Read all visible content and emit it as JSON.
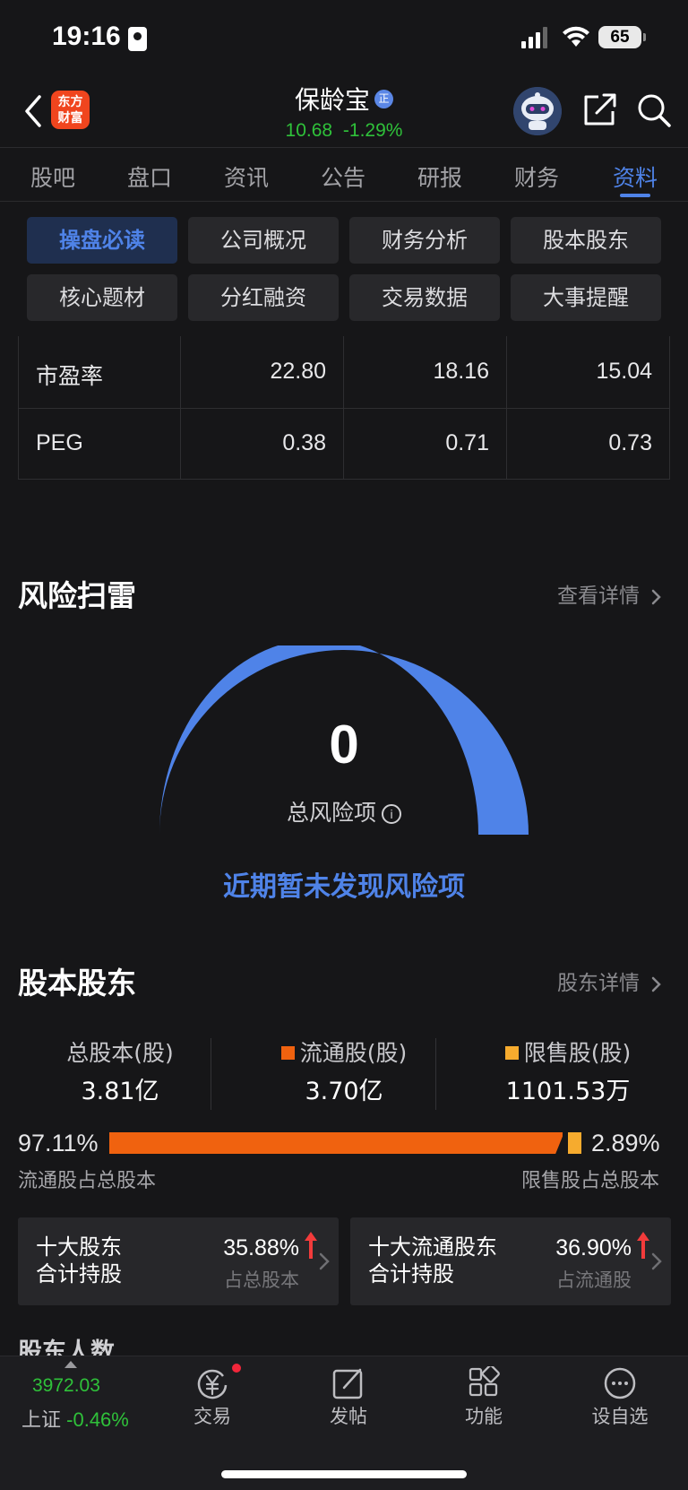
{
  "status_bar": {
    "time": "19:16",
    "battery": "65"
  },
  "header": {
    "logo_line1": "东方",
    "logo_line2": "财富",
    "stock_name": "保龄宝",
    "badge": "正",
    "price": "10.68",
    "change_pct": "-1.29%"
  },
  "tabs": [
    "股吧",
    "盘口",
    "资讯",
    "公告",
    "研报",
    "财务",
    "资料"
  ],
  "active_tab": "资料",
  "sub_nav": [
    "操盘必读",
    "公司概况",
    "财务分析",
    "股本股东",
    "核心题材",
    "分红融资",
    "交易数据",
    "大事提醒"
  ],
  "valuation_table": {
    "rows": [
      {
        "label": "市盈率",
        "values": [
          "22.80",
          "18.16",
          "15.04"
        ]
      },
      {
        "label": "PEG",
        "values": [
          "0.38",
          "0.71",
          "0.73"
        ]
      }
    ]
  },
  "risk": {
    "title": "风险扫雷",
    "link": "查看详情",
    "total": "0",
    "total_label": "总风险项",
    "info_glyph": "i",
    "message": "近期暂未发现风险项"
  },
  "shares": {
    "title": "股本股东",
    "link": "股东详情",
    "total_label": "总股本(股)",
    "total_value": "3.81亿",
    "float_label": "流通股(股)",
    "float_value": "3.70亿",
    "restricted_label": "限售股(股)",
    "restricted_value": "1101.53万",
    "float_pct": "97.11%",
    "restricted_pct": "2.89%",
    "float_pct_value": 0.9711,
    "float_caption": "流通股占总股本",
    "restricted_caption": "限售股占总股本",
    "colors": {
      "float": "#f0620f",
      "restricted": "#f6ab2e"
    }
  },
  "holder_cards": [
    {
      "title_line1": "十大股东",
      "title_line2": "合计持股",
      "pct": "35.88%",
      "sub": "占总股本"
    },
    {
      "title_line1": "十大流通股东",
      "title_line2": "合计持股",
      "pct": "36.90%",
      "sub": "占流通股"
    }
  ],
  "next_section_partial": "股东人数",
  "bottom_bar": {
    "index_value": "3972.03",
    "index_name": "上证",
    "index_change": "-0.46%",
    "items": [
      "交易",
      "发帖",
      "功能",
      "设自选"
    ]
  }
}
